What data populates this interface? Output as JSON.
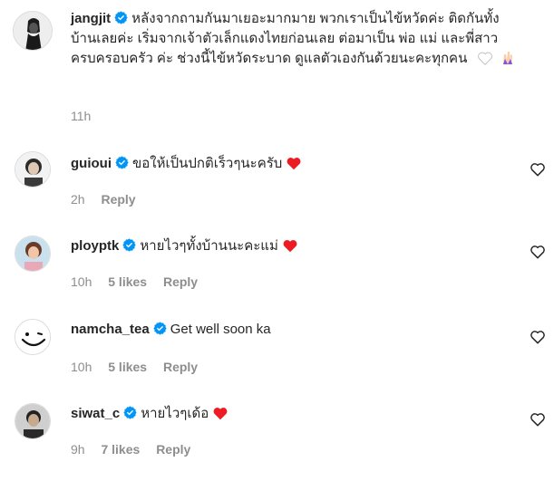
{
  "post": {
    "username": "jangjit",
    "caption": "หลังจากถามกันมาเยอะมากมาย พวกเราเป็นไข้หวัดค่ะ ติดกันทั้งบ้านเลยค่ะ เริ่มจากเจ้าตัวเล็กแดงไทยก่อนเลย ต่อมาเป็น พ่อ แม่ และพี่สาว ครบครอบครัว ค่ะ ช่วงนี้ไข้หวัดระบาด ดูแลตัวเองกันด้วยนะคะทุกคน",
    "time": "11h",
    "verified": true
  },
  "comments": [
    {
      "username": "guioui",
      "text": "ขอให้เป็นปกติเร็วๆนะครับ",
      "time": "2h",
      "likes": "",
      "reply": "Reply",
      "heart": true,
      "verified": true
    },
    {
      "username": "ployptk",
      "text": "หายไวๆทั้งบ้านนะคะแม่",
      "time": "10h",
      "likes": "5 likes",
      "reply": "Reply",
      "heart": true,
      "verified": true
    },
    {
      "username": "namcha_tea",
      "text": "Get well soon ka",
      "time": "10h",
      "likes": "5 likes",
      "reply": "Reply",
      "heart": false,
      "verified": true
    },
    {
      "username": "siwat_c",
      "text": "หายไวๆเด้อ",
      "time": "9h",
      "likes": "7 likes",
      "reply": "Reply",
      "heart": true,
      "verified": true
    }
  ],
  "colors": {
    "verified": "#0095f6",
    "heart": "#ed1c24",
    "meta": "#8e8e8e",
    "text": "#262626"
  },
  "icons": {
    "verified": "verified-badge-icon",
    "heart": "red-heart-emoji-icon",
    "like": "heart-outline-icon",
    "white-heart": "white-heart-emoji-icon",
    "hands": "raised-hands-emoji-icon"
  }
}
